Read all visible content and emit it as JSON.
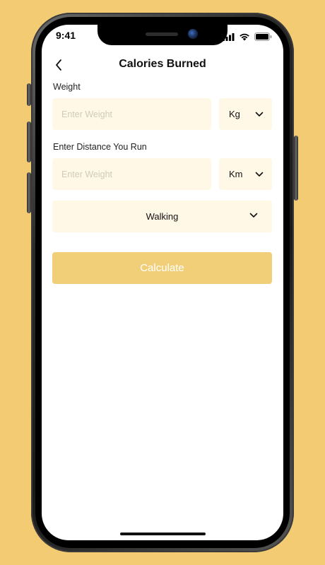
{
  "status_bar": {
    "time": "9:41"
  },
  "header": {
    "title": "Calories Burned"
  },
  "weight": {
    "label": "Weight",
    "placeholder": "Enter Weight",
    "value": "",
    "unit": "Kg"
  },
  "distance": {
    "label": "Enter Distance You Run",
    "placeholder": "Enter Weight",
    "value": "",
    "unit": "Km"
  },
  "activity": {
    "selected": "Walking"
  },
  "actions": {
    "calculate_label": "Calculate"
  },
  "colors": {
    "background": "#F2CB72",
    "field_bg": "#FFF8E6",
    "button_bg": "#F1CF78",
    "button_text": "#FFFFFF"
  },
  "icons": {
    "back": "chevron-left-icon",
    "dropdown": "chevron-down-icon",
    "signal": "cellular-signal-icon",
    "wifi": "wifi-icon",
    "battery": "battery-icon"
  }
}
